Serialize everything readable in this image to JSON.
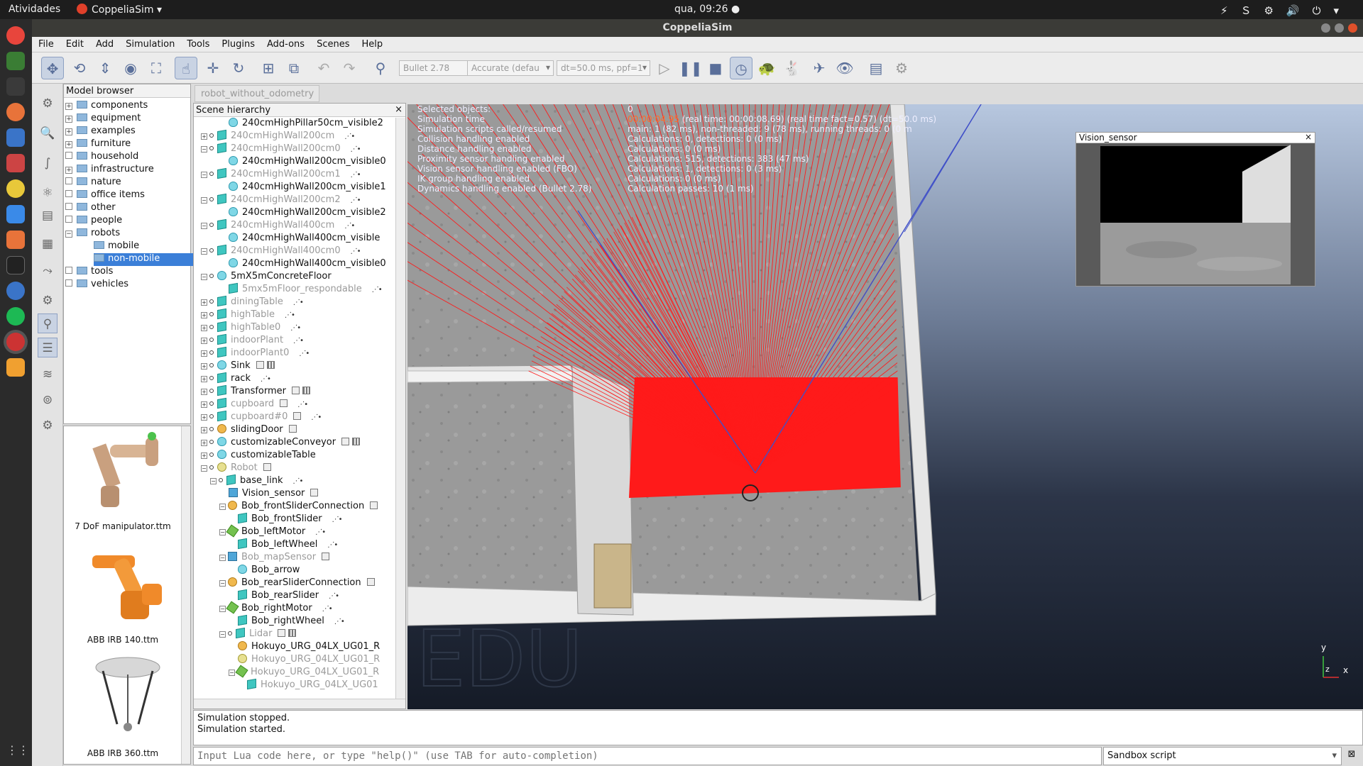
{
  "topbar": {
    "activities": "Atividades",
    "app": "CoppeliaSim ▾",
    "clock": "qua, 09:26 ●",
    "tray": "⚡Ｓ⚙🔊⏻▾"
  },
  "window": {
    "title": "CoppeliaSim"
  },
  "menu": [
    "File",
    "Edit",
    "Add",
    "Simulation",
    "Tools",
    "Plugins",
    "Add-ons",
    "Scenes",
    "Help"
  ],
  "toolbar": {
    "engine": "Bullet 2.78",
    "accuracy": "Accurate (defau",
    "timestep": "dt=50.0 ms, ppf=1"
  },
  "model_browser": {
    "title": "Model browser",
    "items": [
      {
        "label": "components",
        "exp": "+",
        "level": 0
      },
      {
        "label": "equipment",
        "exp": "+",
        "level": 0
      },
      {
        "label": "examples",
        "exp": "+",
        "level": 0
      },
      {
        "label": "furniture",
        "exp": "+",
        "level": 0
      },
      {
        "label": "household",
        "exp": "",
        "level": 0
      },
      {
        "label": "infrastructure",
        "exp": "+",
        "level": 0
      },
      {
        "label": "nature",
        "exp": "",
        "level": 0
      },
      {
        "label": "office items",
        "exp": "",
        "level": 0
      },
      {
        "label": "other",
        "exp": "",
        "level": 0
      },
      {
        "label": "people",
        "exp": "",
        "level": 0
      },
      {
        "label": "robots",
        "exp": "−",
        "level": 0
      },
      {
        "label": "mobile",
        "exp": "",
        "level": 1
      },
      {
        "label": "non-mobile",
        "exp": "",
        "level": 1,
        "selected": true
      },
      {
        "label": "tools",
        "exp": "",
        "level": 0
      },
      {
        "label": "vehicles",
        "exp": "",
        "level": 0
      }
    ]
  },
  "thumbs": [
    {
      "label": "7 DoF manipulator.ttm",
      "color": "#c9a07f"
    },
    {
      "label": "ABB IRB 140.ttm",
      "color": "#f08a2a"
    },
    {
      "label": "ABB IRB 360.ttm",
      "color": "#c8c8c8"
    }
  ],
  "scene": {
    "tab": "robot_without_odometry",
    "title": "Scene hierarchy",
    "close": "×",
    "rows": [
      {
        "label": "240cmHighPillar50cm_visible2",
        "level": 2,
        "icon": "shape",
        "dim": false,
        "exp": "",
        "dot": false,
        "tick": false
      },
      {
        "label": "240cmHighWall200cm",
        "level": 0,
        "icon": "cube",
        "dim": true,
        "exp": "+",
        "dot": true,
        "tick": true
      },
      {
        "label": "240cmHighWall200cm0",
        "level": 0,
        "icon": "cube",
        "dim": true,
        "exp": "−",
        "dot": true,
        "tick": true
      },
      {
        "label": "240cmHighWall200cm_visible0",
        "level": 2,
        "icon": "shape",
        "dim": false,
        "exp": "",
        "dot": false,
        "tick": false
      },
      {
        "label": "240cmHighWall200cm1",
        "level": 0,
        "icon": "cube",
        "dim": true,
        "exp": "−",
        "dot": true,
        "tick": true
      },
      {
        "label": "240cmHighWall200cm_visible1",
        "level": 2,
        "icon": "shape",
        "dim": false,
        "exp": "",
        "dot": false,
        "tick": false
      },
      {
        "label": "240cmHighWall200cm2",
        "level": 0,
        "icon": "cube",
        "dim": true,
        "exp": "−",
        "dot": true,
        "tick": true
      },
      {
        "label": "240cmHighWall200cm_visible2",
        "level": 2,
        "icon": "shape",
        "dim": false,
        "exp": "",
        "dot": false,
        "tick": false
      },
      {
        "label": "240cmHighWall400cm",
        "level": 0,
        "icon": "cube",
        "dim": true,
        "exp": "−",
        "dot": true,
        "tick": true
      },
      {
        "label": "240cmHighWall400cm_visible",
        "level": 2,
        "icon": "shape",
        "dim": false,
        "exp": "",
        "dot": false,
        "tick": false
      },
      {
        "label": "240cmHighWall400cm0",
        "level": 0,
        "icon": "cube",
        "dim": true,
        "exp": "−",
        "dot": true,
        "tick": true
      },
      {
        "label": "240cmHighWall400cm_visible0",
        "level": 2,
        "icon": "shape",
        "dim": false,
        "exp": "",
        "dot": false,
        "tick": false
      },
      {
        "label": "5mX5mConcreteFloor",
        "level": 0,
        "icon": "shape",
        "dim": false,
        "exp": "−",
        "dot": true,
        "tick": false
      },
      {
        "label": "5mx5mFloor_respondable",
        "level": 2,
        "icon": "cube",
        "dim": true,
        "exp": "",
        "dot": false,
        "tick": true
      },
      {
        "label": "diningTable",
        "level": 0,
        "icon": "cube",
        "dim": true,
        "exp": "+",
        "dot": true,
        "tick": true
      },
      {
        "label": "highTable",
        "level": 0,
        "icon": "cube",
        "dim": true,
        "exp": "+",
        "dot": true,
        "tick": true
      },
      {
        "label": "highTable0",
        "level": 0,
        "icon": "cube",
        "dim": true,
        "exp": "+",
        "dot": true,
        "tick": true
      },
      {
        "label": "indoorPlant",
        "level": 0,
        "icon": "cube",
        "dim": true,
        "exp": "+",
        "dot": true,
        "tick": true
      },
      {
        "label": "indoorPlant0",
        "level": 0,
        "icon": "cube",
        "dim": true,
        "exp": "+",
        "dot": true,
        "tick": true
      },
      {
        "label": "Sink",
        "level": 0,
        "icon": "shape",
        "dim": false,
        "exp": "+",
        "dot": true,
        "tick": false,
        "badge": true,
        "badge2": true
      },
      {
        "label": "rack",
        "level": 0,
        "icon": "cube",
        "dim": false,
        "exp": "+",
        "dot": true,
        "tick": true
      },
      {
        "label": "Transformer",
        "level": 0,
        "icon": "cube",
        "dim": false,
        "exp": "+",
        "dot": true,
        "tick": false,
        "badge": true,
        "badge2": true
      },
      {
        "label": "cupboard",
        "level": 0,
        "icon": "cube",
        "dim": true,
        "exp": "+",
        "dot": true,
        "tick": true,
        "badge": true
      },
      {
        "label": "cupboard#0",
        "level": 0,
        "icon": "cube",
        "dim": true,
        "exp": "+",
        "dot": true,
        "tick": true,
        "badge": true
      },
      {
        "label": "slidingDoor",
        "level": 0,
        "icon": "joint",
        "dim": false,
        "exp": "+",
        "dot": true,
        "tick": false,
        "badge": true
      },
      {
        "label": "customizableConveyor",
        "level": 0,
        "icon": "shape",
        "dim": false,
        "exp": "+",
        "dot": true,
        "tick": false,
        "badge": true,
        "badge2": true
      },
      {
        "label": "customizableTable",
        "level": 0,
        "icon": "shape",
        "dim": false,
        "exp": "+",
        "dot": true,
        "tick": false
      },
      {
        "label": "Robot",
        "level": 0,
        "icon": "dummy",
        "dim": true,
        "exp": "−",
        "dot": true,
        "tick": false,
        "badge": true
      },
      {
        "label": "base_link",
        "level": 1,
        "icon": "cube",
        "dim": false,
        "exp": "−",
        "dot": true,
        "tick": true
      },
      {
        "label": "Vision_sensor",
        "level": 2,
        "icon": "cam",
        "dim": false,
        "exp": "",
        "dot": false,
        "tick": false,
        "badge": true
      },
      {
        "label": "Bob_frontSliderConnection",
        "level": 2,
        "icon": "joint",
        "dim": false,
        "exp": "−",
        "dot": false,
        "tick": false,
        "badge": true
      },
      {
        "label": "Bob_frontSlider",
        "level": 3,
        "icon": "cube",
        "dim": false,
        "exp": "",
        "dot": false,
        "tick": true
      },
      {
        "label": "Bob_leftMotor",
        "level": 2,
        "icon": "motor",
        "dim": false,
        "exp": "−",
        "dot": false,
        "tick": true
      },
      {
        "label": "Bob_leftWheel",
        "level": 3,
        "icon": "cube",
        "dim": false,
        "exp": "",
        "dot": false,
        "tick": true
      },
      {
        "label": "Bob_mapSensor",
        "level": 2,
        "icon": "cam",
        "dim": true,
        "exp": "−",
        "dot": false,
        "tick": false,
        "badge": true
      },
      {
        "label": "Bob_arrow",
        "level": 3,
        "icon": "shape",
        "dim": false,
        "exp": "",
        "dot": false,
        "tick": false
      },
      {
        "label": "Bob_rearSliderConnection",
        "level": 2,
        "icon": "joint",
        "dim": false,
        "exp": "−",
        "dot": false,
        "tick": false,
        "badge": true
      },
      {
        "label": "Bob_rearSlider",
        "level": 3,
        "icon": "cube",
        "dim": false,
        "exp": "",
        "dot": false,
        "tick": true
      },
      {
        "label": "Bob_rightMotor",
        "level": 2,
        "icon": "motor",
        "dim": false,
        "exp": "−",
        "dot": false,
        "tick": true
      },
      {
        "label": "Bob_rightWheel",
        "level": 3,
        "icon": "cube",
        "dim": false,
        "exp": "",
        "dot": false,
        "tick": true
      },
      {
        "label": "Lidar",
        "level": 2,
        "icon": "cube",
        "dim": true,
        "exp": "−",
        "dot": true,
        "tick": false,
        "badge": true,
        "badge2": true
      },
      {
        "label": "Hokuyo_URG_04LX_UG01_R",
        "level": 3,
        "icon": "joint",
        "dim": false,
        "exp": "",
        "dot": false,
        "tick": false
      },
      {
        "label": "Hokuyo_URG_04LX_UG01_R",
        "level": 3,
        "icon": "dummy",
        "dim": true,
        "exp": "",
        "dot": false,
        "tick": false
      },
      {
        "label": "Hokuyo_URG_04LX_UG01_R",
        "level": 3,
        "icon": "motor",
        "dim": true,
        "exp": "−",
        "dot": false,
        "tick": false
      },
      {
        "label": "Hokuyo_URG_04LX_UG01",
        "level": 4,
        "icon": "cube",
        "dim": true,
        "exp": "",
        "dot": false,
        "tick": false
      }
    ]
  },
  "overlay": {
    "labels": [
      "Selected objects:",
      "Simulation time",
      "Simulation scripts called/resumed",
      "Collision handling enabled",
      "Distance handling enabled",
      "Proximity sensor handling enabled",
      "Vision sensor handling enabled (FBO)",
      "IK group handling enabled",
      "Dynamics handling enabled (Bullet 2.78)"
    ],
    "values": [
      "0",
      "00:00:04.95",
      "main: 1 (82 ms), non-threaded: 9 (78 ms), running threads: 0 (0 m",
      "Calculations: 0, detections: 0 (0 ms)",
      "Calculations: 0 (0 ms)",
      "Calculations: 515, detections: 383 (47 ms)",
      "Calculations: 1, detections: 0 (3 ms)",
      "Calculations: 0 (0 ms)",
      "Calculation passes: 10 (1 ms)"
    ],
    "time_suffix": " (real time: 00:00:08.69) (real time fact=0.57) (dt=50.0 ms)"
  },
  "watermark": "EDU",
  "axes": {
    "y": "y",
    "z": "z",
    "x": "x"
  },
  "vision_window": {
    "title": "Vision_sensor",
    "close": "×"
  },
  "console": {
    "lines": [
      "Simulation stopped.",
      "Simulation started."
    ]
  },
  "lua_input": {
    "placeholder": "Input Lua code here, or type \"help()\" (use TAB for auto-completion)"
  },
  "script_select": {
    "value": "Sandbox script"
  },
  "colors": {
    "laser": "#ff1a1a",
    "selection": "#3b7fd8",
    "sky": "#7888a3"
  }
}
